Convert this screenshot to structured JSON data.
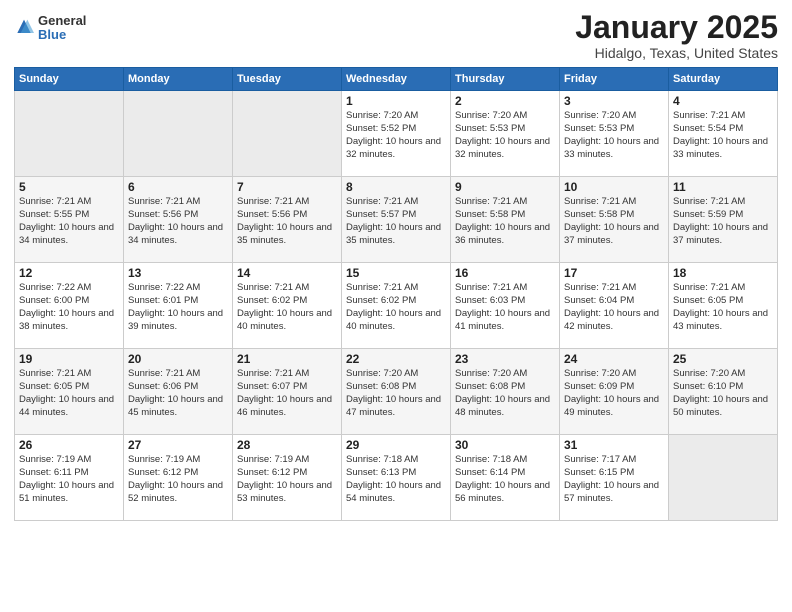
{
  "logo": {
    "general": "General",
    "blue": "Blue"
  },
  "title": "January 2025",
  "location": "Hidalgo, Texas, United States",
  "days_header": [
    "Sunday",
    "Monday",
    "Tuesday",
    "Wednesday",
    "Thursday",
    "Friday",
    "Saturday"
  ],
  "weeks": [
    [
      {
        "day": "",
        "empty": true
      },
      {
        "day": "",
        "empty": true
      },
      {
        "day": "",
        "empty": true
      },
      {
        "day": "1",
        "sunrise": "7:20 AM",
        "sunset": "5:52 PM",
        "daylight": "10 hours and 32 minutes."
      },
      {
        "day": "2",
        "sunrise": "7:20 AM",
        "sunset": "5:53 PM",
        "daylight": "10 hours and 32 minutes."
      },
      {
        "day": "3",
        "sunrise": "7:20 AM",
        "sunset": "5:53 PM",
        "daylight": "10 hours and 33 minutes."
      },
      {
        "day": "4",
        "sunrise": "7:21 AM",
        "sunset": "5:54 PM",
        "daylight": "10 hours and 33 minutes."
      }
    ],
    [
      {
        "day": "5",
        "sunrise": "7:21 AM",
        "sunset": "5:55 PM",
        "daylight": "10 hours and 34 minutes."
      },
      {
        "day": "6",
        "sunrise": "7:21 AM",
        "sunset": "5:56 PM",
        "daylight": "10 hours and 34 minutes."
      },
      {
        "day": "7",
        "sunrise": "7:21 AM",
        "sunset": "5:56 PM",
        "daylight": "10 hours and 35 minutes."
      },
      {
        "day": "8",
        "sunrise": "7:21 AM",
        "sunset": "5:57 PM",
        "daylight": "10 hours and 35 minutes."
      },
      {
        "day": "9",
        "sunrise": "7:21 AM",
        "sunset": "5:58 PM",
        "daylight": "10 hours and 36 minutes."
      },
      {
        "day": "10",
        "sunrise": "7:21 AM",
        "sunset": "5:58 PM",
        "daylight": "10 hours and 37 minutes."
      },
      {
        "day": "11",
        "sunrise": "7:21 AM",
        "sunset": "5:59 PM",
        "daylight": "10 hours and 37 minutes."
      }
    ],
    [
      {
        "day": "12",
        "sunrise": "7:22 AM",
        "sunset": "6:00 PM",
        "daylight": "10 hours and 38 minutes."
      },
      {
        "day": "13",
        "sunrise": "7:22 AM",
        "sunset": "6:01 PM",
        "daylight": "10 hours and 39 minutes."
      },
      {
        "day": "14",
        "sunrise": "7:21 AM",
        "sunset": "6:02 PM",
        "daylight": "10 hours and 40 minutes."
      },
      {
        "day": "15",
        "sunrise": "7:21 AM",
        "sunset": "6:02 PM",
        "daylight": "10 hours and 40 minutes."
      },
      {
        "day": "16",
        "sunrise": "7:21 AM",
        "sunset": "6:03 PM",
        "daylight": "10 hours and 41 minutes."
      },
      {
        "day": "17",
        "sunrise": "7:21 AM",
        "sunset": "6:04 PM",
        "daylight": "10 hours and 42 minutes."
      },
      {
        "day": "18",
        "sunrise": "7:21 AM",
        "sunset": "6:05 PM",
        "daylight": "10 hours and 43 minutes."
      }
    ],
    [
      {
        "day": "19",
        "sunrise": "7:21 AM",
        "sunset": "6:05 PM",
        "daylight": "10 hours and 44 minutes."
      },
      {
        "day": "20",
        "sunrise": "7:21 AM",
        "sunset": "6:06 PM",
        "daylight": "10 hours and 45 minutes."
      },
      {
        "day": "21",
        "sunrise": "7:21 AM",
        "sunset": "6:07 PM",
        "daylight": "10 hours and 46 minutes."
      },
      {
        "day": "22",
        "sunrise": "7:20 AM",
        "sunset": "6:08 PM",
        "daylight": "10 hours and 47 minutes."
      },
      {
        "day": "23",
        "sunrise": "7:20 AM",
        "sunset": "6:08 PM",
        "daylight": "10 hours and 48 minutes."
      },
      {
        "day": "24",
        "sunrise": "7:20 AM",
        "sunset": "6:09 PM",
        "daylight": "10 hours and 49 minutes."
      },
      {
        "day": "25",
        "sunrise": "7:20 AM",
        "sunset": "6:10 PM",
        "daylight": "10 hours and 50 minutes."
      }
    ],
    [
      {
        "day": "26",
        "sunrise": "7:19 AM",
        "sunset": "6:11 PM",
        "daylight": "10 hours and 51 minutes."
      },
      {
        "day": "27",
        "sunrise": "7:19 AM",
        "sunset": "6:12 PM",
        "daylight": "10 hours and 52 minutes."
      },
      {
        "day": "28",
        "sunrise": "7:19 AM",
        "sunset": "6:12 PM",
        "daylight": "10 hours and 53 minutes."
      },
      {
        "day": "29",
        "sunrise": "7:18 AM",
        "sunset": "6:13 PM",
        "daylight": "10 hours and 54 minutes."
      },
      {
        "day": "30",
        "sunrise": "7:18 AM",
        "sunset": "6:14 PM",
        "daylight": "10 hours and 56 minutes."
      },
      {
        "day": "31",
        "sunrise": "7:17 AM",
        "sunset": "6:15 PM",
        "daylight": "10 hours and 57 minutes."
      },
      {
        "day": "",
        "empty": true
      }
    ]
  ],
  "labels": {
    "sunrise_prefix": "Sunrise: ",
    "sunset_prefix": "Sunset: ",
    "daylight_prefix": "Daylight: "
  }
}
